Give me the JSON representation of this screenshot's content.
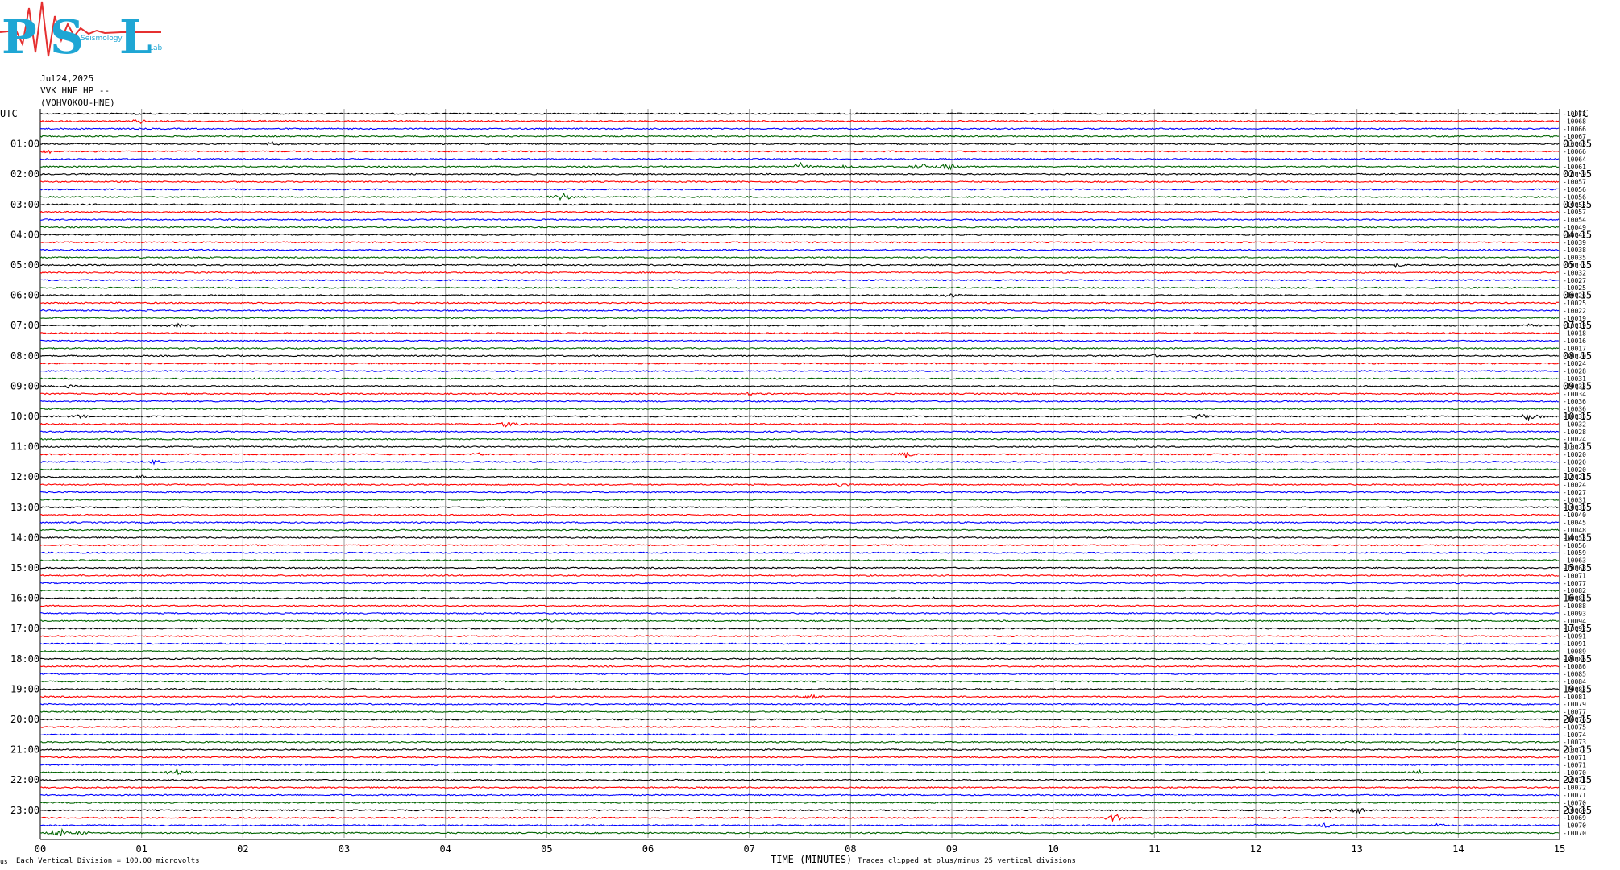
{
  "logo": {
    "letters": [
      "P",
      "S",
      "L"
    ],
    "word1": "",
    "word2": "Seismology",
    "word3": "Lab",
    "colors": {
      "cyan": "#1fa6d4",
      "red": "#e53030"
    }
  },
  "header": {
    "date": "Jul24,2025",
    "station": "VVK HNE HP --",
    "site": "(VOHVOKOU-HNE)"
  },
  "chart_data": {
    "type": "helicorder",
    "left_title": "UTC",
    "right_title": "UTC",
    "left_hour_labels": [
      "01:00",
      "02:00",
      "03:00",
      "04:00",
      "05:00",
      "06:00",
      "07:00",
      "08:00",
      "09:00",
      "10:00",
      "11:00",
      "12:00",
      "13:00",
      "14:00",
      "15:00",
      "16:00",
      "17:00",
      "18:00",
      "19:00",
      "20:00",
      "21:00",
      "22:00",
      "23:00"
    ],
    "right_hour_labels": [
      "01:15",
      "02:15",
      "03:15",
      "04:15",
      "05:15",
      "06:15",
      "07:15",
      "08:15",
      "09:15",
      "10:15",
      "11:15",
      "12:15",
      "13:15",
      "14:15",
      "15:15",
      "16:15",
      "17:15",
      "18:15",
      "19:15",
      "20:15",
      "21:15",
      "22:15",
      "23:15"
    ],
    "x_ticks": [
      "00",
      "01",
      "02",
      "03",
      "04",
      "05",
      "06",
      "07",
      "08",
      "09",
      "10",
      "11",
      "12",
      "13",
      "14",
      "15"
    ],
    "xlabel": "TIME (MINUTES)",
    "xlim": [
      0,
      15
    ],
    "traces_per_hour": 4,
    "trace_count": 96,
    "trace_colors": [
      "#000000",
      "#ff0000",
      "#0000ff",
      "#006400"
    ],
    "right_values": [
      "-10072",
      "-10068",
      "-10066",
      "-10067",
      "-10063",
      "-10066",
      "-10064",
      "-10061",
      "-10059",
      "-10057",
      "-10056",
      "-10056",
      "-10055",
      "-10057",
      "-10054",
      "-10049",
      "-10042",
      "-10039",
      "-10038",
      "-10035",
      "-10035",
      "-10032",
      "-10027",
      "-10025",
      "-10026",
      "-10025",
      "-10022",
      "-10019",
      "-10019",
      "-10018",
      "-10016",
      "-10017",
      "-10020",
      "-10024",
      "-10028",
      "-10031",
      "-10033",
      "-10034",
      "-10036",
      "-10036",
      "-10035",
      "-10032",
      "-10028",
      "-10024",
      "-10022",
      "-10020",
      "-10020",
      "-10020",
      "-10021",
      "-10024",
      "-10027",
      "-10031",
      "-10035",
      "-10040",
      "-10045",
      "-10048",
      "-10053",
      "-10056",
      "-10059",
      "-10063",
      "-10068",
      "-10071",
      "-10077",
      "-10082",
      "-10085",
      "-10088",
      "-10093",
      "-10094",
      "-10092",
      "-10091",
      "-10091",
      "-10089",
      "-10086",
      "-10086",
      "-10085",
      "-10084",
      "-10083",
      "-10081",
      "-10079",
      "-10077",
      "-10076",
      "-10075",
      "-10074",
      "-10073",
      "-10072",
      "-10071",
      "-10071",
      "-10070",
      "-10071",
      "-10072",
      "-10071",
      "-10070",
      "-10069",
      "-10069",
      "-10070",
      "-10070"
    ],
    "events": [
      {
        "trace": 0,
        "minute": 0.95,
        "amp": 2.0
      },
      {
        "trace": 1,
        "minute": 0.98,
        "amp": 3.5
      },
      {
        "trace": 1,
        "minute": 2.1,
        "amp": 2.5
      },
      {
        "trace": 1,
        "minute": 2.45,
        "amp": 2.0
      },
      {
        "trace": 4,
        "minute": 2.3,
        "amp": 2.5
      },
      {
        "trace": 5,
        "minute": 0.05,
        "amp": 3.5
      },
      {
        "trace": 7,
        "minute": 7.5,
        "amp": 5.0
      },
      {
        "trace": 7,
        "minute": 8.0,
        "amp": 4.5
      },
      {
        "trace": 7,
        "minute": 8.7,
        "amp": 5.0
      },
      {
        "trace": 7,
        "minute": 8.95,
        "amp": 5.0
      },
      {
        "trace": 11,
        "minute": 5.15,
        "amp": 5.5
      },
      {
        "trace": 20,
        "minute": 13.4,
        "amp": 3.0
      },
      {
        "trace": 24,
        "minute": 9.0,
        "amp": 3.0
      },
      {
        "trace": 28,
        "minute": 1.35,
        "amp": 4.0
      },
      {
        "trace": 28,
        "minute": 14.7,
        "amp": 3.0
      },
      {
        "trace": 32,
        "minute": 11.0,
        "amp": 2.5
      },
      {
        "trace": 36,
        "minute": 0.3,
        "amp": 3.0
      },
      {
        "trace": 37,
        "minute": 7.0,
        "amp": 2.5
      },
      {
        "trace": 40,
        "minute": 0.4,
        "amp": 3.0
      },
      {
        "trace": 40,
        "minute": 11.45,
        "amp": 4.0
      },
      {
        "trace": 40,
        "minute": 14.7,
        "amp": 4.5
      },
      {
        "trace": 41,
        "minute": 4.6,
        "amp": 4.5
      },
      {
        "trace": 45,
        "minute": 4.3,
        "amp": 2.5
      },
      {
        "trace": 45,
        "minute": 8.55,
        "amp": 4.5
      },
      {
        "trace": 46,
        "minute": 1.1,
        "amp": 3.5
      },
      {
        "trace": 48,
        "minute": 1.0,
        "amp": 3.0
      },
      {
        "trace": 49,
        "minute": 7.9,
        "amp": 2.5
      },
      {
        "trace": 64,
        "minute": 8.8,
        "amp": 2.0
      },
      {
        "trace": 67,
        "minute": 5.0,
        "amp": 2.5
      },
      {
        "trace": 77,
        "minute": 7.6,
        "amp": 5.0
      },
      {
        "trace": 87,
        "minute": 1.35,
        "amp": 5.0
      },
      {
        "trace": 87,
        "minute": 13.6,
        "amp": 2.5
      },
      {
        "trace": 92,
        "minute": 12.7,
        "amp": 3.0
      },
      {
        "trace": 92,
        "minute": 13.0,
        "amp": 4.5
      },
      {
        "trace": 93,
        "minute": 10.6,
        "amp": 5.5
      },
      {
        "trace": 94,
        "minute": 12.0,
        "amp": 3.0
      },
      {
        "trace": 94,
        "minute": 12.7,
        "amp": 3.5
      },
      {
        "trace": 94,
        "minute": 13.8,
        "amp": 3.0
      },
      {
        "trace": 95,
        "minute": 0.2,
        "amp": 5.0
      },
      {
        "trace": 95,
        "minute": 0.4,
        "amp": 3.5
      }
    ],
    "footer_left": "Each Vertical Division =  100.00 microvolts",
    "footer_right": "Traces clipped at plus/minus 25 vertical divisions",
    "footer_mark": "us"
  }
}
